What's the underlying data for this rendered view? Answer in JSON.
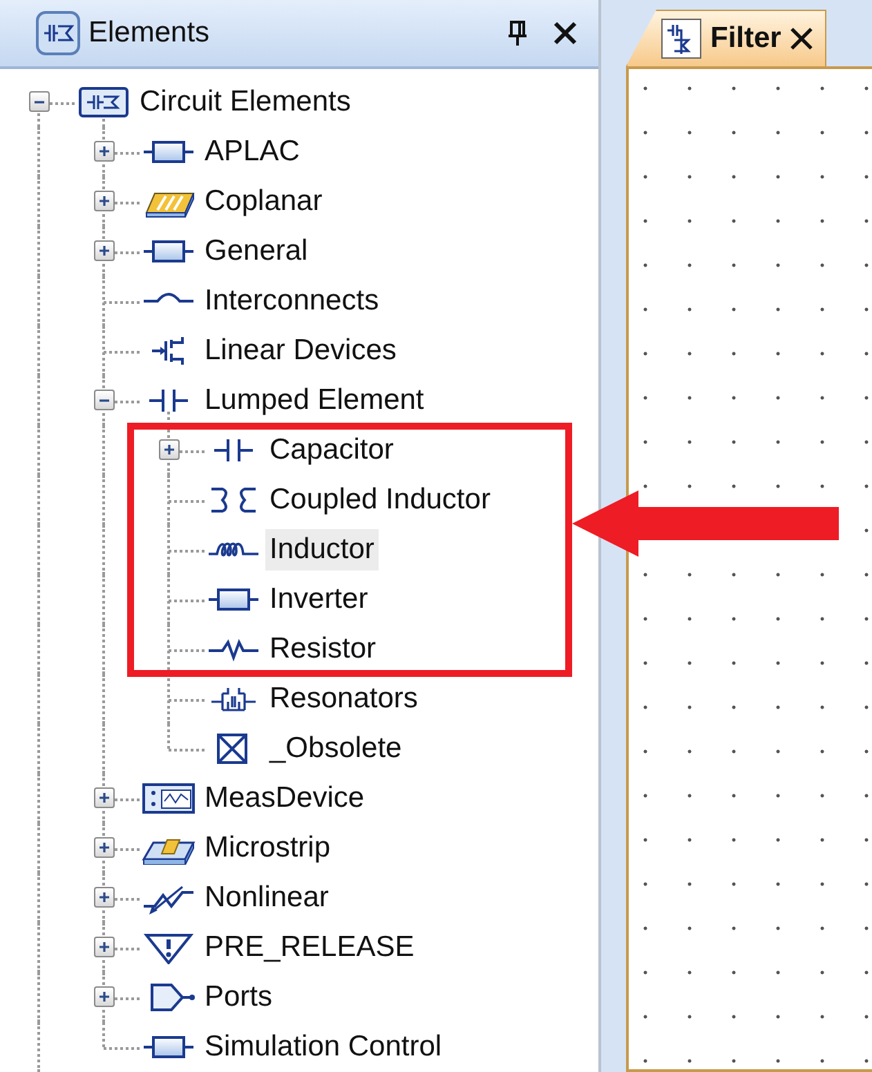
{
  "panel": {
    "title": "Elements"
  },
  "tree": [
    {
      "label": "Circuit Elements",
      "expanded": true,
      "selected": false,
      "children": [
        {
          "label": "APLAC",
          "expanded": false,
          "selected": false
        },
        {
          "label": "Coplanar",
          "expanded": false,
          "selected": false
        },
        {
          "label": "General",
          "expanded": false,
          "selected": false
        },
        {
          "label": "Interconnects",
          "selected": false
        },
        {
          "label": "Linear Devices",
          "selected": false
        },
        {
          "label": "Lumped Element",
          "expanded": true,
          "selected": false,
          "children": [
            {
              "label": "Capacitor",
              "expanded": false,
              "selected": false,
              "boxed": true
            },
            {
              "label": "Coupled Inductor",
              "selected": false,
              "boxed": true
            },
            {
              "label": "Inductor",
              "selected": true,
              "boxed": true
            },
            {
              "label": "Inverter",
              "selected": false,
              "boxed": true
            },
            {
              "label": "Resistor",
              "selected": false,
              "boxed": true
            },
            {
              "label": "Resonators",
              "selected": false,
              "boxed": false
            },
            {
              "label": "_Obsolete",
              "selected": false,
              "boxed": false
            }
          ]
        },
        {
          "label": "MeasDevice",
          "expanded": false,
          "selected": false
        },
        {
          "label": "Microstrip",
          "expanded": false,
          "selected": false
        },
        {
          "label": "Nonlinear",
          "expanded": false,
          "selected": false
        },
        {
          "label": "PRE_RELEASE",
          "expanded": false,
          "selected": false
        },
        {
          "label": "Ports",
          "expanded": false,
          "selected": false
        },
        {
          "label": "Simulation Control",
          "selected": false
        }
      ]
    }
  ],
  "document_tabs": [
    {
      "label": "Filter",
      "selected": true
    }
  ]
}
